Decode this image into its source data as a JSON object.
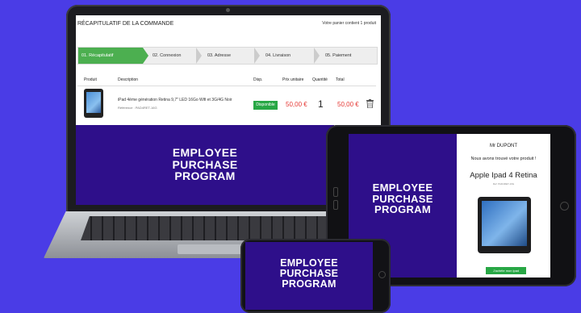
{
  "shop": {
    "title": "RÉCAPITULATIF DE LA COMMANDE",
    "cart_info": "Votre panier contient 1 produit",
    "steps": [
      "01. Récapitulatif",
      "02. Connexion",
      "03. Adresse",
      "04. Livraison",
      "05. Paiement"
    ],
    "columns": [
      "Produit",
      "Description",
      "Disp.",
      "Prix unitaire",
      "Quantité",
      "Total"
    ],
    "row": {
      "description": "iPad 4ème génération Retina 9,7\" LED 16Go Wifi et 3G/4G Noir",
      "reference": "Référence : PAD4RET-16G",
      "availability": "Disponible",
      "unit_price": "50,00 €",
      "quantity": "1",
      "total": "50,00 €"
    }
  },
  "banner": {
    "line1": "EMPLOYEE",
    "line2": "PURCHASE",
    "line3": "PROGRAM"
  },
  "tablet": {
    "greeting": "Mr DUPONT",
    "message": "Nous avons trouvé votre produit !",
    "product": "Apple Ipad 4 Retina",
    "small_text": "Ref: PAD4RET-16G",
    "button": "J'achète mon ipad"
  },
  "colors": {
    "background": "#4a3ce6",
    "banner": "#2e0f8a",
    "active_step": "#4caf50",
    "price": "#e53935",
    "badge": "#28a745"
  }
}
